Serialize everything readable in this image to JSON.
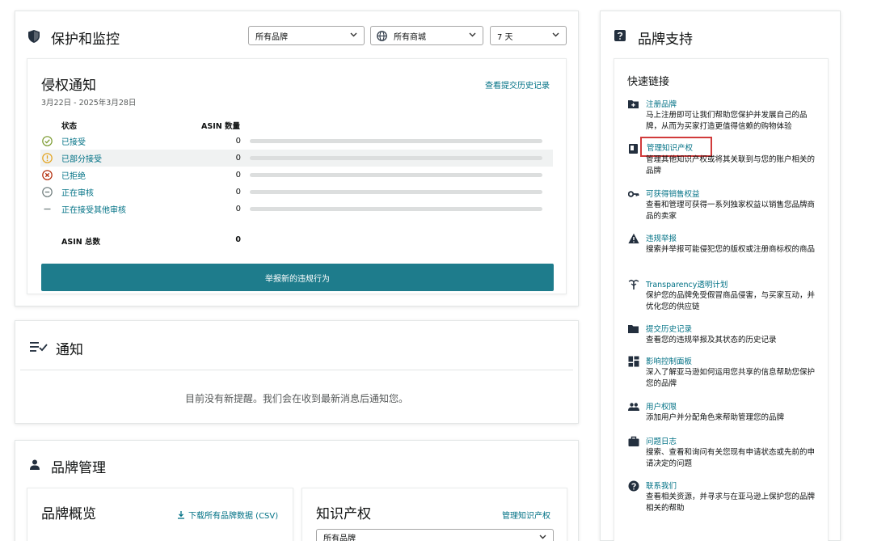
{
  "protection": {
    "title": "保护和监控",
    "brand_filter": "所有品牌",
    "marketplace_filter": "所有商城",
    "period_filter": "7 天"
  },
  "infringement": {
    "title": "侵权通知",
    "date_range": "3月22日 - 2025年3月28日",
    "history_link": "查看提交历史记录",
    "col_status": "状态",
    "col_asin": "ASIN 数量",
    "rows": [
      {
        "label": "已接受",
        "count": "0"
      },
      {
        "label": "已部分接受",
        "count": "0"
      },
      {
        "label": "已拒绝",
        "count": "0"
      },
      {
        "label": "正在审核",
        "count": "0"
      },
      {
        "label": "正在接受其他审核",
        "count": "0"
      }
    ],
    "total_label": "ASIN 总数",
    "total_count": "0",
    "report_button": "举报新的违规行为"
  },
  "notifications": {
    "title": "通知",
    "empty_message": "目前没有新提醒。我们会在收到最新消息后通知您。"
  },
  "brand_management": {
    "title": "品牌管理",
    "overview_title": "品牌概览",
    "download_link": "下载所有品牌数据 (CSV)",
    "ip_title": "知识产权",
    "ip_manage_link": "管理知识产权",
    "ip_select": "所有品牌"
  },
  "brand_support": {
    "title": "品牌支持",
    "quick_links_title": "快速链接",
    "links": [
      {
        "title": "注册品牌",
        "desc": "马上注册即可让我们帮助您保护并发展自己的品牌，从而为买家打造更值得信赖的购物体验",
        "icon": "register-brand-icon"
      },
      {
        "title": "管理知识产权",
        "desc": "管理其他知识产权或将其关联到与您的账户相关的品牌",
        "icon": "ip-book-icon"
      },
      {
        "title": "可获得销售权益",
        "desc": "查看和管理可获得一系列独家权益以销售您品牌商品的卖家",
        "icon": "key-icon"
      },
      {
        "title": "违规举报",
        "desc": "搜索并举报可能侵犯您的版权或注册商标权的商品",
        "icon": "warning-icon"
      },
      {
        "title": "Transparency透明计划",
        "desc": "保护您的品牌免受假冒商品侵害，与买家互动，并优化您的供应链",
        "icon": "transparency-icon"
      },
      {
        "title": "提交历史记录",
        "desc": "查看您的违规举报及其状态的历史记录",
        "icon": "folder-icon"
      },
      {
        "title": "影响控制面板",
        "desc": "深入了解亚马逊如何运用您共享的信息帮助您保护您的品牌",
        "icon": "dashboard-icon"
      },
      {
        "title": "用户权限",
        "desc": "添加用户并分配角色来帮助管理您的品牌",
        "icon": "users-icon"
      },
      {
        "title": "问题日志",
        "desc": "搜索、查看和询问有关您现有申请状态或先前的申请决定的问题",
        "icon": "briefcase-icon"
      },
      {
        "title": "联系我们",
        "desc": "查看相关资源，并寻求与在亚马逊上保护您的品牌相关的帮助",
        "icon": "help-icon"
      }
    ]
  },
  "colors": {
    "accent_teal": "#1e7c8c",
    "link": "#007185",
    "highlight_box": "#d13b3b",
    "accepted": "#7a9a2e",
    "partial": "#e3a21a",
    "rejected": "#b12704",
    "review": "#6c7a7a"
  }
}
